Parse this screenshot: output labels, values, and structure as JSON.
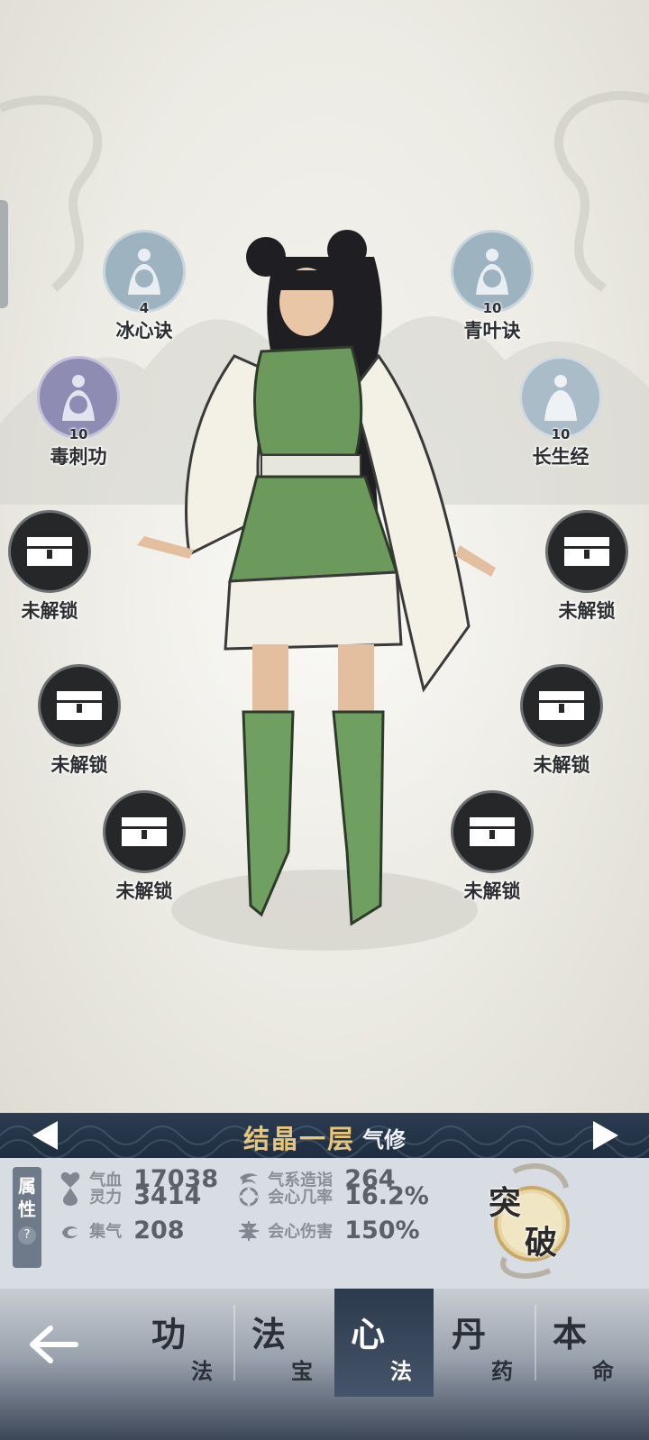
{
  "skills_top": [
    {
      "name": "冰心诀",
      "level": "4",
      "element": "水",
      "icon": "water-figure-icon"
    },
    {
      "name": "青叶诀",
      "level": "10",
      "element": "木",
      "icon": "wood-figure-icon"
    },
    {
      "name": "毒刺功",
      "level": "10",
      "element": "木",
      "icon": "wood-figure-icon"
    },
    {
      "name": "长生经",
      "level": "10",
      "element": "",
      "icon": "figure-icon"
    }
  ],
  "locked_slots": [
    "未解锁",
    "未解锁",
    "未解锁",
    "未解锁",
    "未解锁",
    "未解锁"
  ],
  "realm": {
    "name": "结晶一层",
    "type": "气修"
  },
  "attributes_tab": {
    "line1": "属",
    "line2": "性",
    "help": "?"
  },
  "stats": [
    {
      "name": "气血",
      "value": "17038",
      "icon": "heart-icon"
    },
    {
      "name": "灵力",
      "value": "3414",
      "icon": "drop-icon"
    },
    {
      "name": "集气",
      "value": "208",
      "icon": "swirl-icon"
    },
    {
      "name": "气系造诣",
      "value": "264",
      "icon": "wind-icon"
    },
    {
      "name": "会心几率",
      "value": "16.2%",
      "icon": "crit-rate-icon"
    },
    {
      "name": "会心伤害",
      "value": "150%",
      "icon": "crit-damage-icon"
    }
  ],
  "breakthrough": {
    "char1": "突",
    "char2": "破"
  },
  "nav_tabs": [
    {
      "big": "功",
      "small": "法"
    },
    {
      "big": "法",
      "small": "宝"
    },
    {
      "big": "心",
      "small": "法"
    },
    {
      "big": "丹",
      "small": "药"
    },
    {
      "big": "本",
      "small": "命"
    }
  ],
  "active_tab": 2,
  "colors": {
    "realm_gold": "#e7c57b",
    "bar_dark": "#1e2d3f",
    "stats_bg": "#d7dde3"
  }
}
